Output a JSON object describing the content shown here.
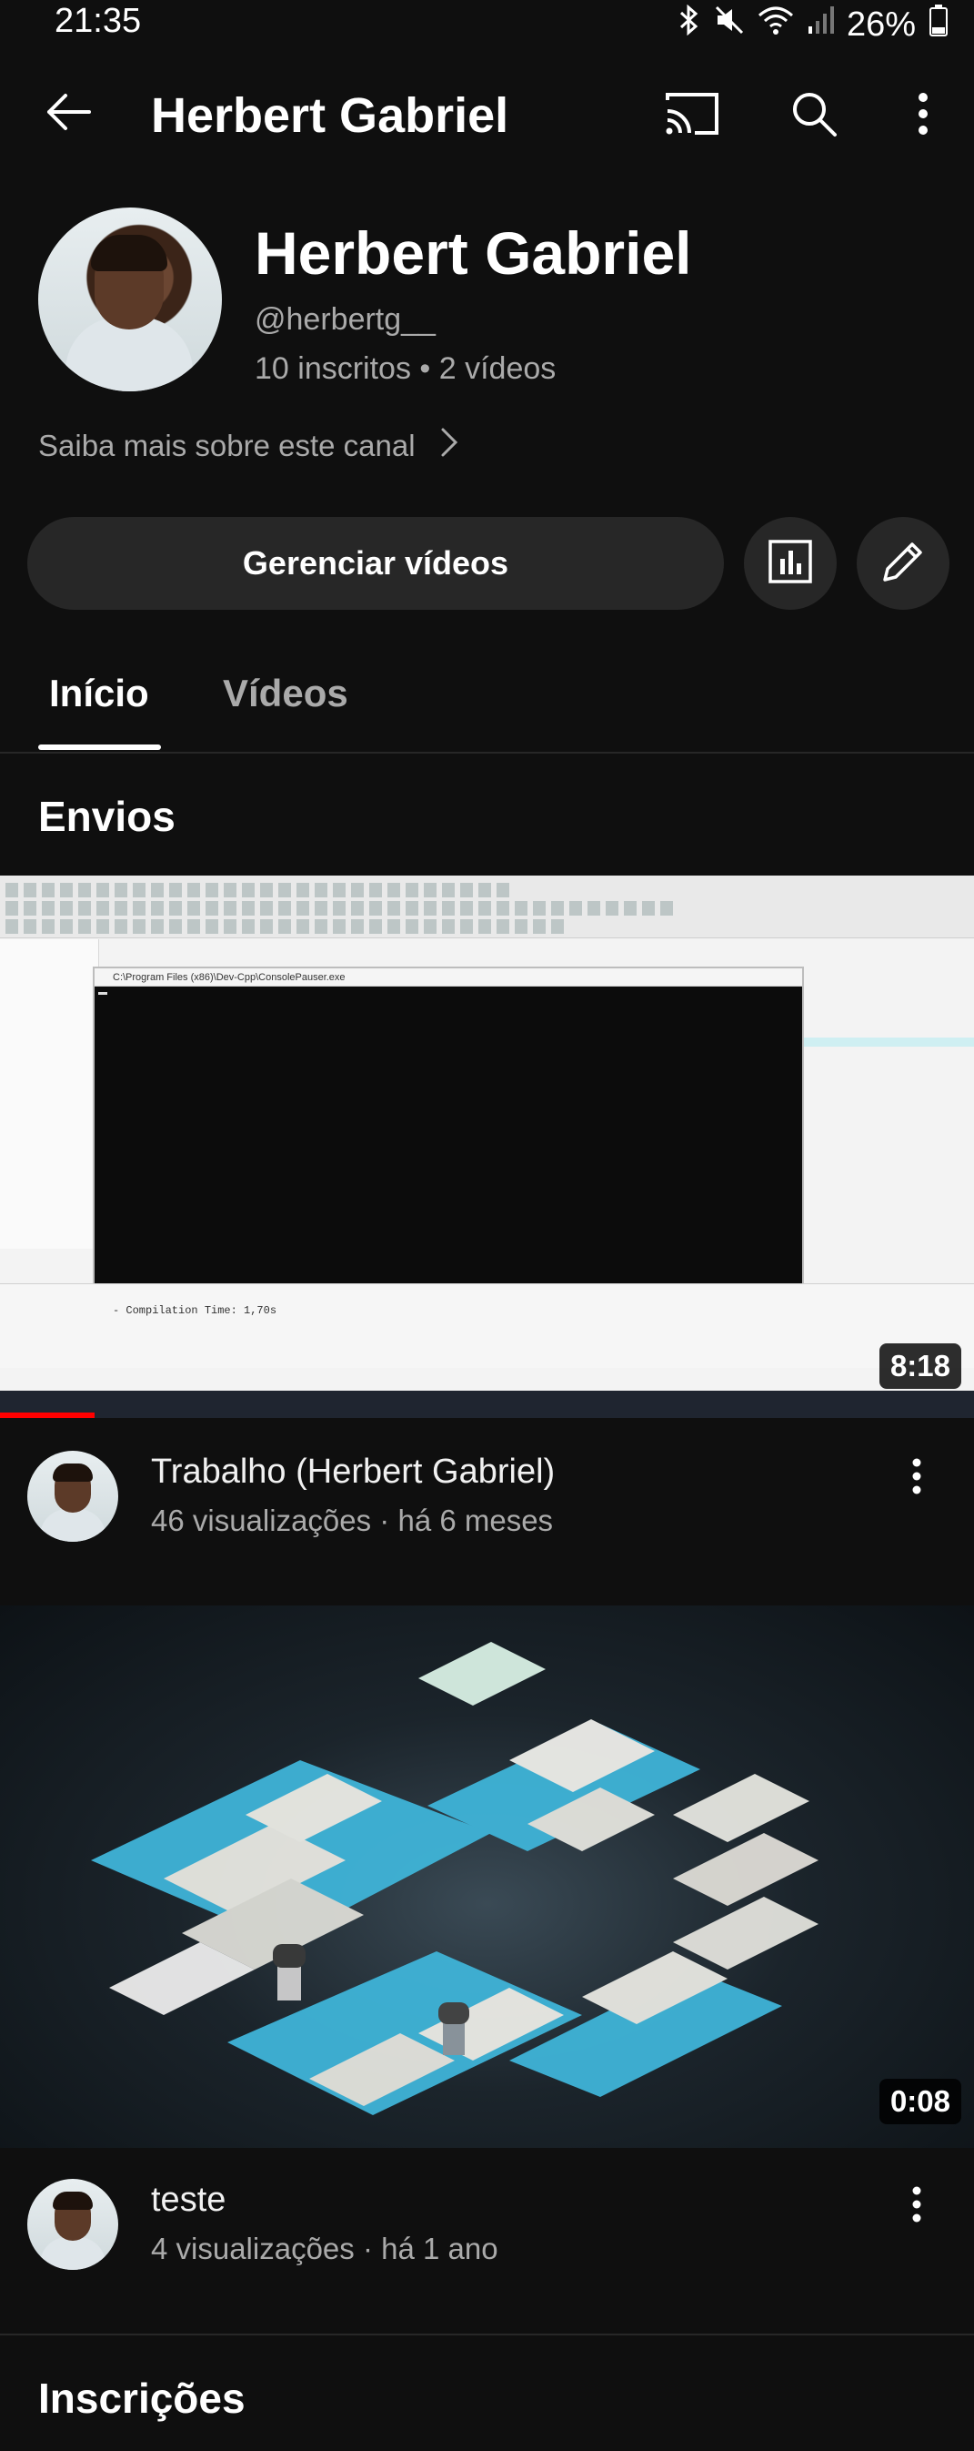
{
  "status_bar": {
    "time": "21:35",
    "battery": "26%"
  },
  "app_bar": {
    "title": "Herbert Gabriel"
  },
  "channel": {
    "name": "Herbert Gabriel",
    "handle": "@herbertg__",
    "stats": "10 inscritos • 2 vídeos",
    "about_link": "Saiba mais sobre este canal"
  },
  "actions": {
    "manage_videos": "Gerenciar vídeos"
  },
  "tabs": [
    {
      "label": "Início",
      "active": true
    },
    {
      "label": "Vídeos",
      "active": false
    }
  ],
  "sections": {
    "uploads": "Envios",
    "subscriptions": "Inscrições"
  },
  "videos": [
    {
      "title": "Trabalho (Herbert Gabriel)",
      "meta": "46 visualizações · há 6 meses",
      "duration": "8:18"
    },
    {
      "title": "teste",
      "meta": "4 visualizações · há 1 ano",
      "duration": "0:08"
    }
  ],
  "thumbnail1_text": {
    "console_title": "C:\\Program Files (x86)\\Dev-Cpp\\ConsolePauser.exe",
    "compile_line": "- Compilation Time: 1,70s"
  },
  "colors": {
    "background": "#0f0f0f",
    "surface": "#272727",
    "text_secondary": "#aaaaaa",
    "progress": "#ff0000"
  },
  "icons": [
    "back-arrow-icon",
    "cast-icon",
    "search-icon",
    "more-vert-icon",
    "chevron-right-icon",
    "analytics-icon",
    "edit-pencil-icon"
  ]
}
